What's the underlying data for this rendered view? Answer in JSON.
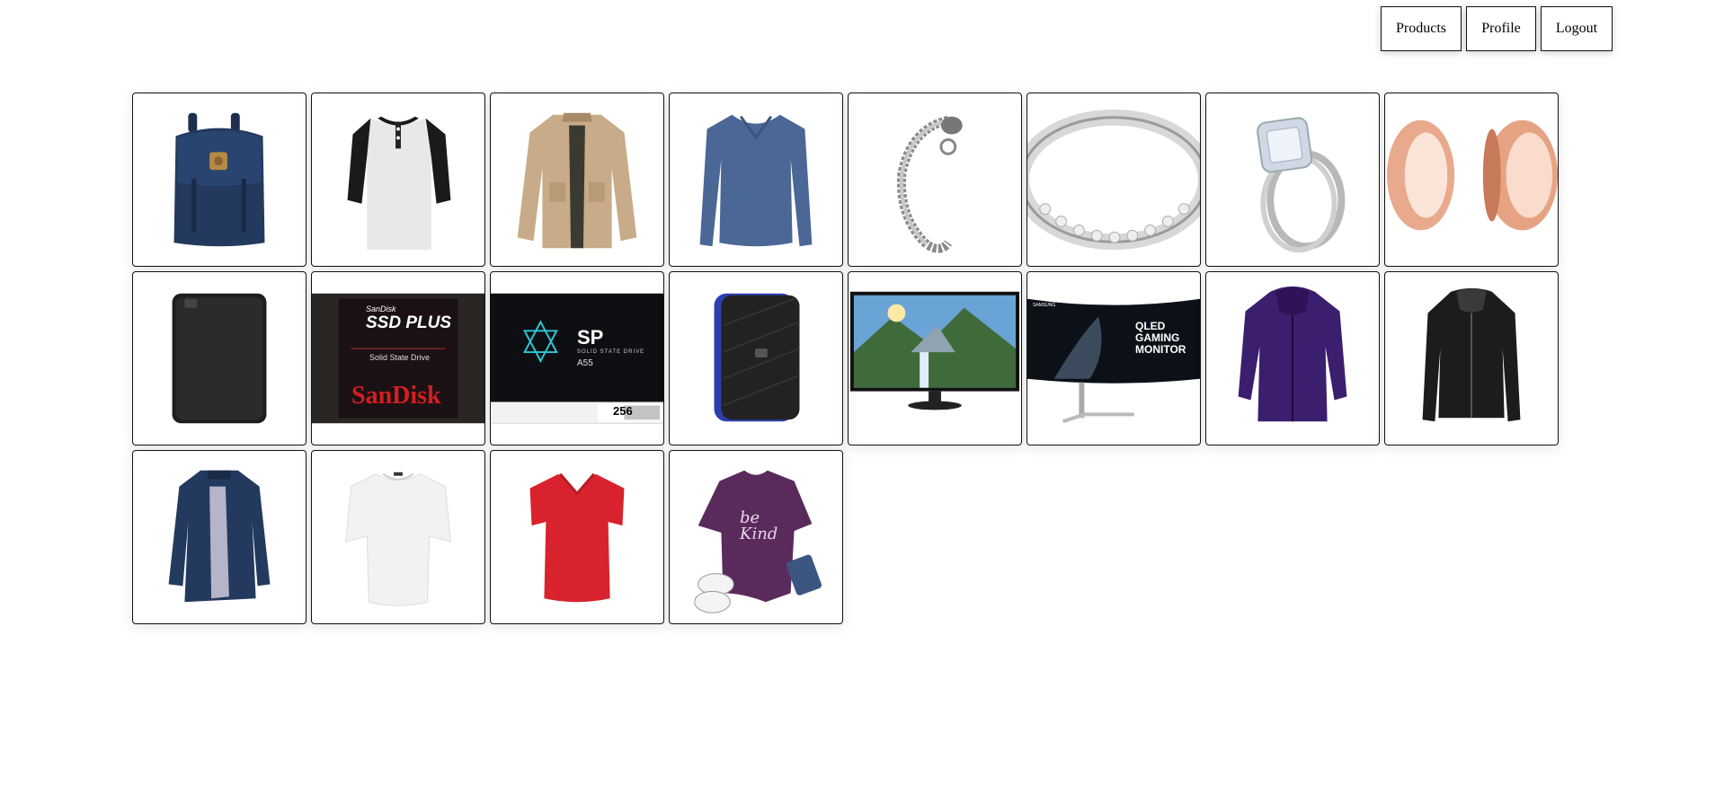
{
  "nav": {
    "products_label": "Products",
    "profile_label": "Profile",
    "logout_label": "Logout"
  },
  "products": [
    {
      "image": "navy-backpack"
    },
    {
      "image": "raglan-henley-shirt"
    },
    {
      "image": "khaki-field-jacket"
    },
    {
      "image": "blue-long-sleeve-vneck"
    },
    {
      "image": "silver-dragon-chain-bracelet"
    },
    {
      "image": "silver-crystal-bangle"
    },
    {
      "image": "diamond-halo-ring-set"
    },
    {
      "image": "rose-gold-ear-tunnels"
    },
    {
      "image": "black-external-hard-drive"
    },
    {
      "image": "sandisk-ssd-plus",
      "brand_text": "SanDisk",
      "product_text": "SSD PLUS",
      "sub_text": "Solid State Drive"
    },
    {
      "image": "silicon-power-ssd",
      "brand_text": "SP",
      "sub_text": "SOLID STATE DRIVE",
      "model_text": "A55",
      "capacity_text": "256"
    },
    {
      "image": "wd-gaming-drive"
    },
    {
      "image": "widescreen-monitor-landscape"
    },
    {
      "image": "samsung-curved-gaming-monitor",
      "brand_text": "SAMSUNG",
      "product_text": "QLED GAMING MONITOR"
    },
    {
      "image": "purple-3in1-jacket"
    },
    {
      "image": "black-leather-hooded-jacket"
    },
    {
      "image": "navy-trench-coat"
    },
    {
      "image": "white-dolman-top"
    },
    {
      "image": "red-vneck-tshirt"
    },
    {
      "image": "purple-be-kind-tee",
      "print_text": "be Kind"
    }
  ],
  "colors": {
    "border": "#111111",
    "navy": "#233a5e",
    "purple": "#3c1e6e",
    "red": "#d8232e",
    "sandisk_red": "#d41d20",
    "khaki": "#c8ab88"
  }
}
